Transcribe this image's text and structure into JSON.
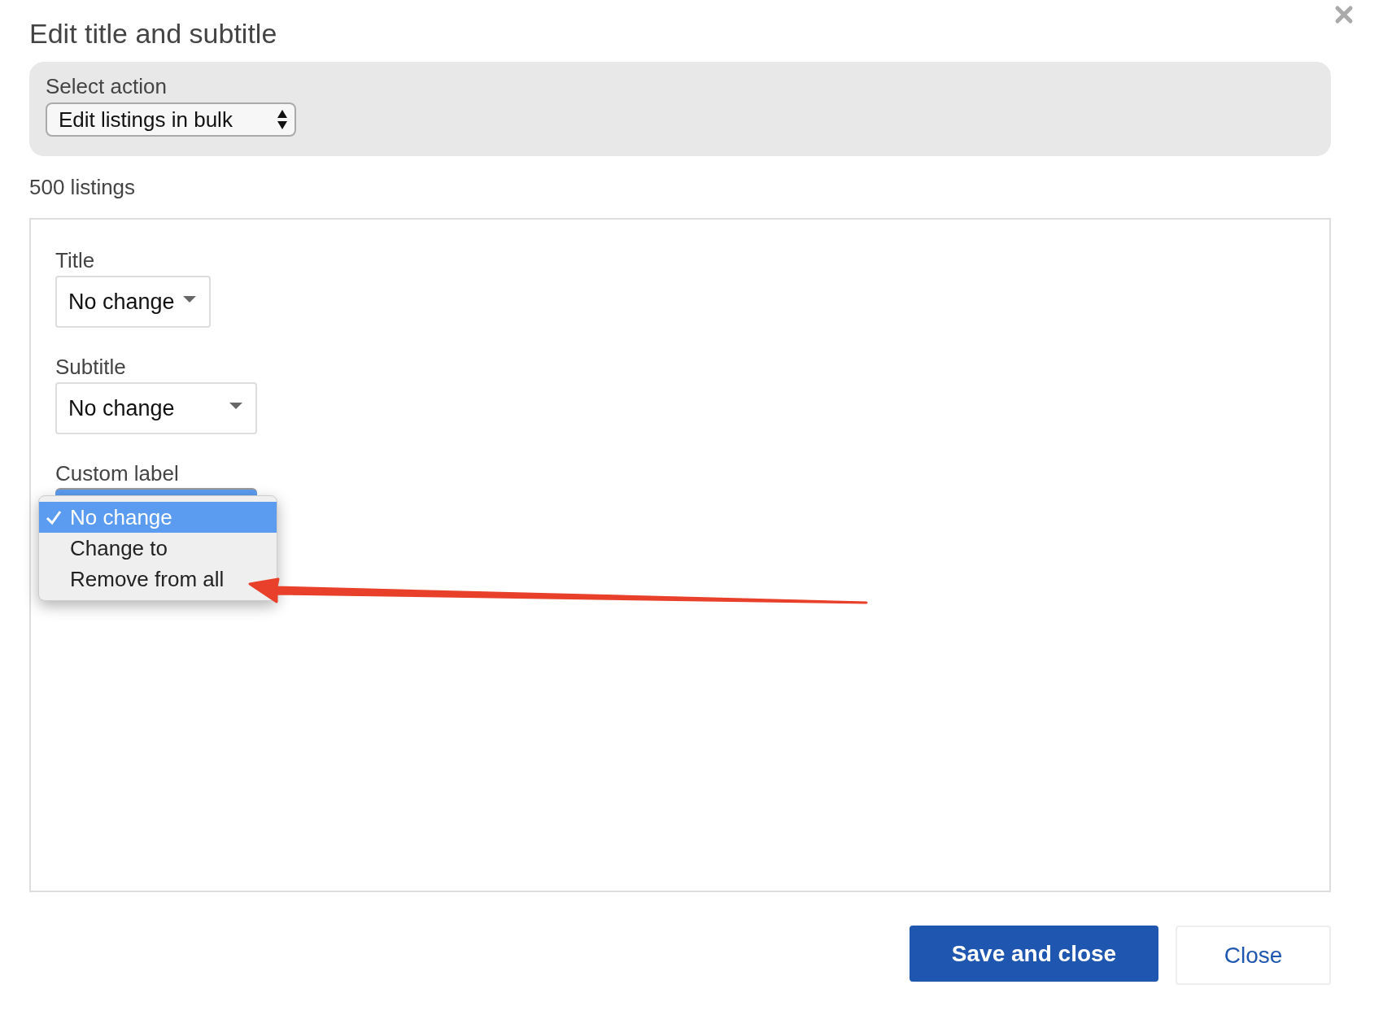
{
  "dialog": {
    "title": "Edit title and subtitle"
  },
  "action_panel": {
    "label": "Select action",
    "value": "Edit listings in bulk"
  },
  "listing_count": "500 listings",
  "fields": [
    {
      "label": "Title",
      "value": "No change"
    },
    {
      "label": "Subtitle",
      "value": "No change"
    },
    {
      "label": "Custom label",
      "open": true
    }
  ],
  "dropdown_menu": [
    {
      "label": "No change",
      "selected": true
    },
    {
      "label": "Change to",
      "selected": false
    },
    {
      "label": "Remove from all",
      "selected": false
    }
  ],
  "buttons": [
    {
      "label": "Save and close",
      "kind": "primary"
    },
    {
      "label": "Close",
      "kind": "secondary"
    }
  ]
}
